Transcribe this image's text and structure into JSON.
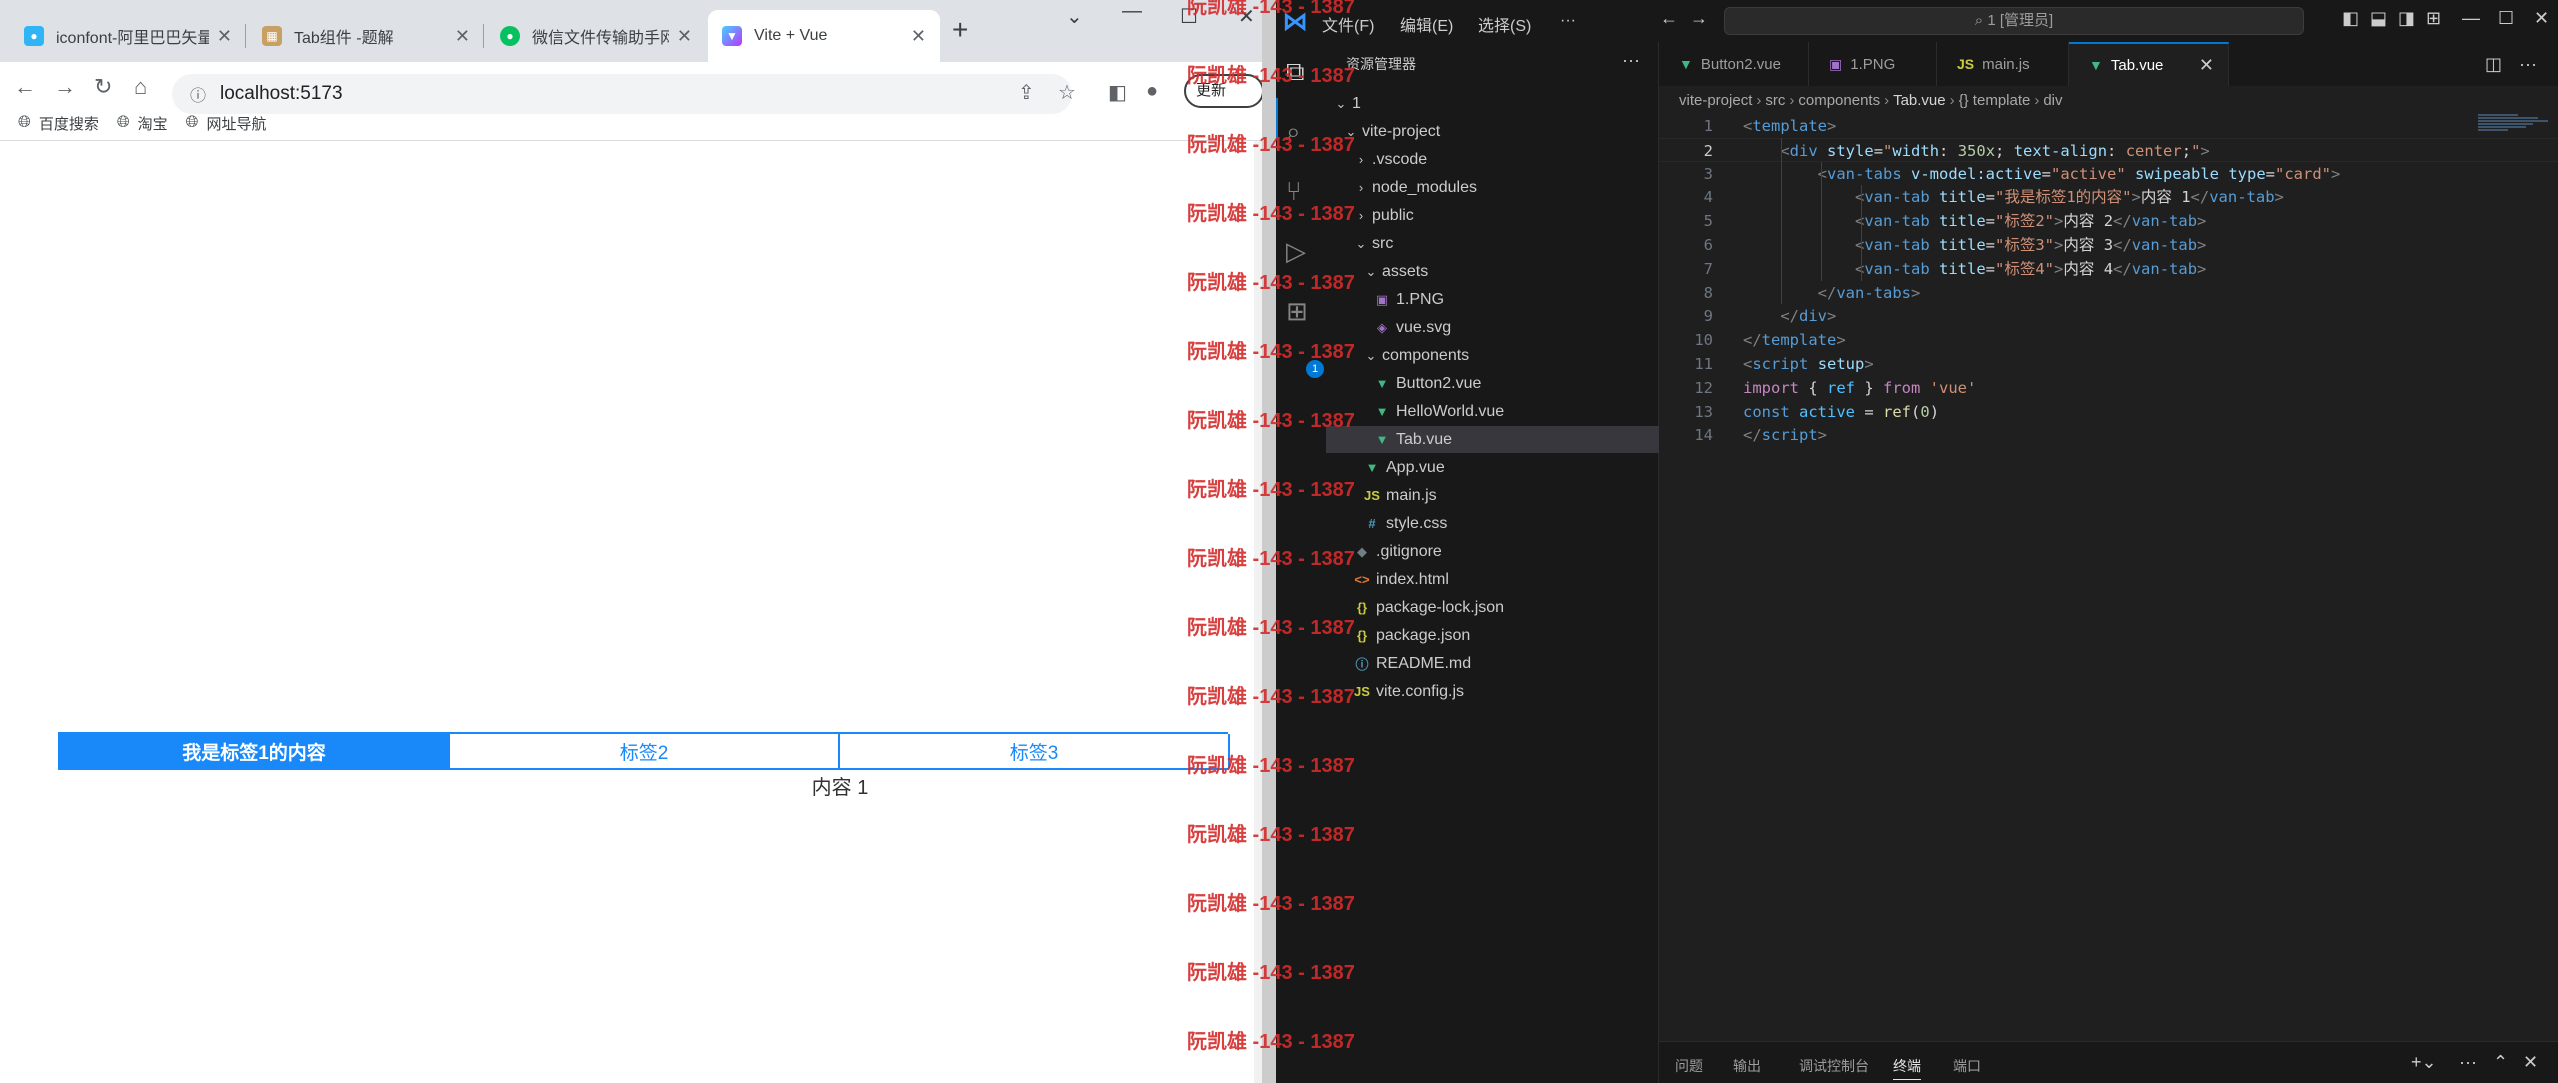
{
  "browser": {
    "tabs": [
      {
        "title": "iconfont-阿里巴巴矢量",
        "icon": "iconfont-favicon",
        "color": "#2fb4f5"
      },
      {
        "title": "Tab组件 -题解",
        "icon": "tab-favicon",
        "color": "#c8a063"
      },
      {
        "title": "微信文件传输助手网页",
        "icon": "wechat-favicon",
        "color": "#07c160"
      },
      {
        "title": "Vite + Vue",
        "icon": "vite-favicon",
        "color": "#7c5cff"
      }
    ],
    "url": "localhost:5173",
    "update_label": "更新",
    "bookmarks": [
      "百度搜索",
      "淘宝",
      "网址导航"
    ]
  },
  "page": {
    "tabs": [
      "我是标签1的内容",
      "标签2",
      "标签3"
    ],
    "content": "内容 1",
    "accent": "#1989fa"
  },
  "vscode": {
    "menu": [
      "文件(F)",
      "编辑(E)",
      "选择(S)",
      "···"
    ],
    "command_center": "1 [管理员]",
    "explorer": {
      "title": "资源管理器",
      "items": [
        {
          "label": "1",
          "type": "folder-open",
          "indent": 0
        },
        {
          "label": "vite-project",
          "type": "folder-open",
          "indent": 1
        },
        {
          "label": ".vscode",
          "type": "folder",
          "indent": 2
        },
        {
          "label": "node_modules",
          "type": "folder",
          "indent": 2
        },
        {
          "label": "public",
          "type": "folder",
          "indent": 2
        },
        {
          "label": "src",
          "type": "folder-open",
          "indent": 2
        },
        {
          "label": "assets",
          "type": "folder-open",
          "indent": 3
        },
        {
          "label": "1.PNG",
          "type": "image",
          "indent": 4
        },
        {
          "label": "vue.svg",
          "type": "svg",
          "indent": 4
        },
        {
          "label": "components",
          "type": "folder-open",
          "indent": 3
        },
        {
          "label": "Button2.vue",
          "type": "vue",
          "indent": 4
        },
        {
          "label": "HelloWorld.vue",
          "type": "vue",
          "indent": 4
        },
        {
          "label": "Tab.vue",
          "type": "vue",
          "indent": 4,
          "selected": true
        },
        {
          "label": "App.vue",
          "type": "vue",
          "indent": 3
        },
        {
          "label": "main.js",
          "type": "js",
          "indent": 3
        },
        {
          "label": "style.css",
          "type": "css",
          "indent": 3
        },
        {
          "label": ".gitignore",
          "type": "git",
          "indent": 2
        },
        {
          "label": "index.html",
          "type": "html",
          "indent": 2
        },
        {
          "label": "package-lock.json",
          "type": "json",
          "indent": 2
        },
        {
          "label": "package.json",
          "type": "json",
          "indent": 2
        },
        {
          "label": "README.md",
          "type": "info",
          "indent": 2
        },
        {
          "label": "vite.config.js",
          "type": "js",
          "indent": 2
        }
      ]
    },
    "editor_tabs": [
      {
        "label": "Button2.vue",
        "type": "vue"
      },
      {
        "label": "1.PNG",
        "type": "image"
      },
      {
        "label": "main.js",
        "type": "js"
      },
      {
        "label": "Tab.vue",
        "type": "vue",
        "active": true
      }
    ],
    "breadcrumb": [
      "vite-project",
      "src",
      "components",
      "Tab.vue",
      "{} template",
      "div"
    ],
    "current_line": 2,
    "code": [
      [
        [
          "tk-br",
          "<"
        ],
        [
          "tk-tag",
          "template"
        ],
        [
          "tk-br",
          ">"
        ]
      ],
      [
        [
          "tk-txt",
          "    "
        ],
        [
          "tk-br",
          "<"
        ],
        [
          "tk-tag",
          "div"
        ],
        [
          "tk-txt",
          " "
        ],
        [
          "tk-attr",
          "style"
        ],
        [
          "tk-txt",
          "="
        ],
        [
          "tk-str",
          "\""
        ],
        [
          "tk-attr",
          "width"
        ],
        [
          "tk-css",
          ": "
        ],
        [
          "tk-num",
          "350x"
        ],
        [
          "tk-css",
          "; "
        ],
        [
          "tk-attr",
          "text-align"
        ],
        [
          "tk-css",
          ": "
        ],
        [
          "tk-str",
          "center"
        ],
        [
          "tk-css",
          ";"
        ],
        [
          "tk-str",
          "\""
        ],
        [
          "tk-br",
          ">"
        ]
      ],
      [
        [
          "tk-txt",
          "        "
        ],
        [
          "tk-br",
          "<"
        ],
        [
          "tk-tag",
          "van-tabs"
        ],
        [
          "tk-txt",
          " "
        ],
        [
          "tk-attr",
          "v-model:active"
        ],
        [
          "tk-txt",
          "="
        ],
        [
          "tk-str",
          "\"active\""
        ],
        [
          "tk-txt",
          " "
        ],
        [
          "tk-attr",
          "swipeable"
        ],
        [
          "tk-txt",
          " "
        ],
        [
          "tk-attr",
          "type"
        ],
        [
          "tk-txt",
          "="
        ],
        [
          "tk-str",
          "\"card\""
        ],
        [
          "tk-br",
          ">"
        ]
      ],
      [
        [
          "tk-txt",
          "            "
        ],
        [
          "tk-br",
          "<"
        ],
        [
          "tk-tag",
          "van-tab"
        ],
        [
          "tk-txt",
          " "
        ],
        [
          "tk-attr",
          "title"
        ],
        [
          "tk-txt",
          "="
        ],
        [
          "tk-str",
          "\"我是标签1的内容\""
        ],
        [
          "tk-br",
          ">"
        ],
        [
          "tk-txt",
          "内容 1"
        ],
        [
          "tk-br",
          "</"
        ],
        [
          "tk-tag",
          "van-tab"
        ],
        [
          "tk-br",
          ">"
        ]
      ],
      [
        [
          "tk-txt",
          "            "
        ],
        [
          "tk-br",
          "<"
        ],
        [
          "tk-tag",
          "van-tab"
        ],
        [
          "tk-txt",
          " "
        ],
        [
          "tk-attr",
          "title"
        ],
        [
          "tk-txt",
          "="
        ],
        [
          "tk-str",
          "\"标签2\""
        ],
        [
          "tk-br",
          ">"
        ],
        [
          "tk-txt",
          "内容 2"
        ],
        [
          "tk-br",
          "</"
        ],
        [
          "tk-tag",
          "van-tab"
        ],
        [
          "tk-br",
          ">"
        ]
      ],
      [
        [
          "tk-txt",
          "            "
        ],
        [
          "tk-br",
          "<"
        ],
        [
          "tk-tag",
          "van-tab"
        ],
        [
          "tk-txt",
          " "
        ],
        [
          "tk-attr",
          "title"
        ],
        [
          "tk-txt",
          "="
        ],
        [
          "tk-str",
          "\"标签3\""
        ],
        [
          "tk-br",
          ">"
        ],
        [
          "tk-txt",
          "内容 3"
        ],
        [
          "tk-br",
          "</"
        ],
        [
          "tk-tag",
          "van-tab"
        ],
        [
          "tk-br",
          ">"
        ]
      ],
      [
        [
          "tk-txt",
          "            "
        ],
        [
          "tk-br",
          "<"
        ],
        [
          "tk-tag",
          "van-tab"
        ],
        [
          "tk-txt",
          " "
        ],
        [
          "tk-attr",
          "title"
        ],
        [
          "tk-txt",
          "="
        ],
        [
          "tk-str",
          "\"标签4\""
        ],
        [
          "tk-br",
          ">"
        ],
        [
          "tk-txt",
          "内容 4"
        ],
        [
          "tk-br",
          "</"
        ],
        [
          "tk-tag",
          "van-tab"
        ],
        [
          "tk-br",
          ">"
        ]
      ],
      [
        [
          "tk-txt",
          "        "
        ],
        [
          "tk-br",
          "</"
        ],
        [
          "tk-tag",
          "van-tabs"
        ],
        [
          "tk-br",
          ">"
        ]
      ],
      [
        [
          "tk-txt",
          "    "
        ],
        [
          "tk-br",
          "</"
        ],
        [
          "tk-tag",
          "div"
        ],
        [
          "tk-br",
          ">"
        ]
      ],
      [
        [
          "tk-br",
          "</"
        ],
        [
          "tk-tag",
          "template"
        ],
        [
          "tk-br",
          ">"
        ]
      ],
      [
        [
          "tk-br",
          "<"
        ],
        [
          "tk-tag",
          "script"
        ],
        [
          "tk-txt",
          " "
        ],
        [
          "tk-attr",
          "setup"
        ],
        [
          "tk-br",
          ">"
        ]
      ],
      [
        [
          "tk-kw",
          "import"
        ],
        [
          "tk-txt",
          " { "
        ],
        [
          "tk-var",
          "ref"
        ],
        [
          "tk-txt",
          " } "
        ],
        [
          "tk-kw",
          "from"
        ],
        [
          "tk-txt",
          " "
        ],
        [
          "tk-str",
          "'vue'"
        ]
      ],
      [
        [
          "tk-kw2",
          "const"
        ],
        [
          "tk-txt",
          " "
        ],
        [
          "tk-var",
          "active"
        ],
        [
          "tk-txt",
          " = "
        ],
        [
          "tk-fn",
          "ref"
        ],
        [
          "tk-txt",
          "("
        ],
        [
          "tk-num",
          "0"
        ],
        [
          "tk-txt",
          ")"
        ]
      ],
      [
        [
          "tk-br",
          "</"
        ],
        [
          "tk-tag",
          "script"
        ],
        [
          "tk-br",
          ">"
        ]
      ]
    ],
    "panel_tabs": [
      "问题",
      "输出",
      "调试控制台",
      "终端",
      "端口"
    ],
    "panel_active": "终端"
  },
  "watermark": "阮凯雄 -143 - 1387"
}
